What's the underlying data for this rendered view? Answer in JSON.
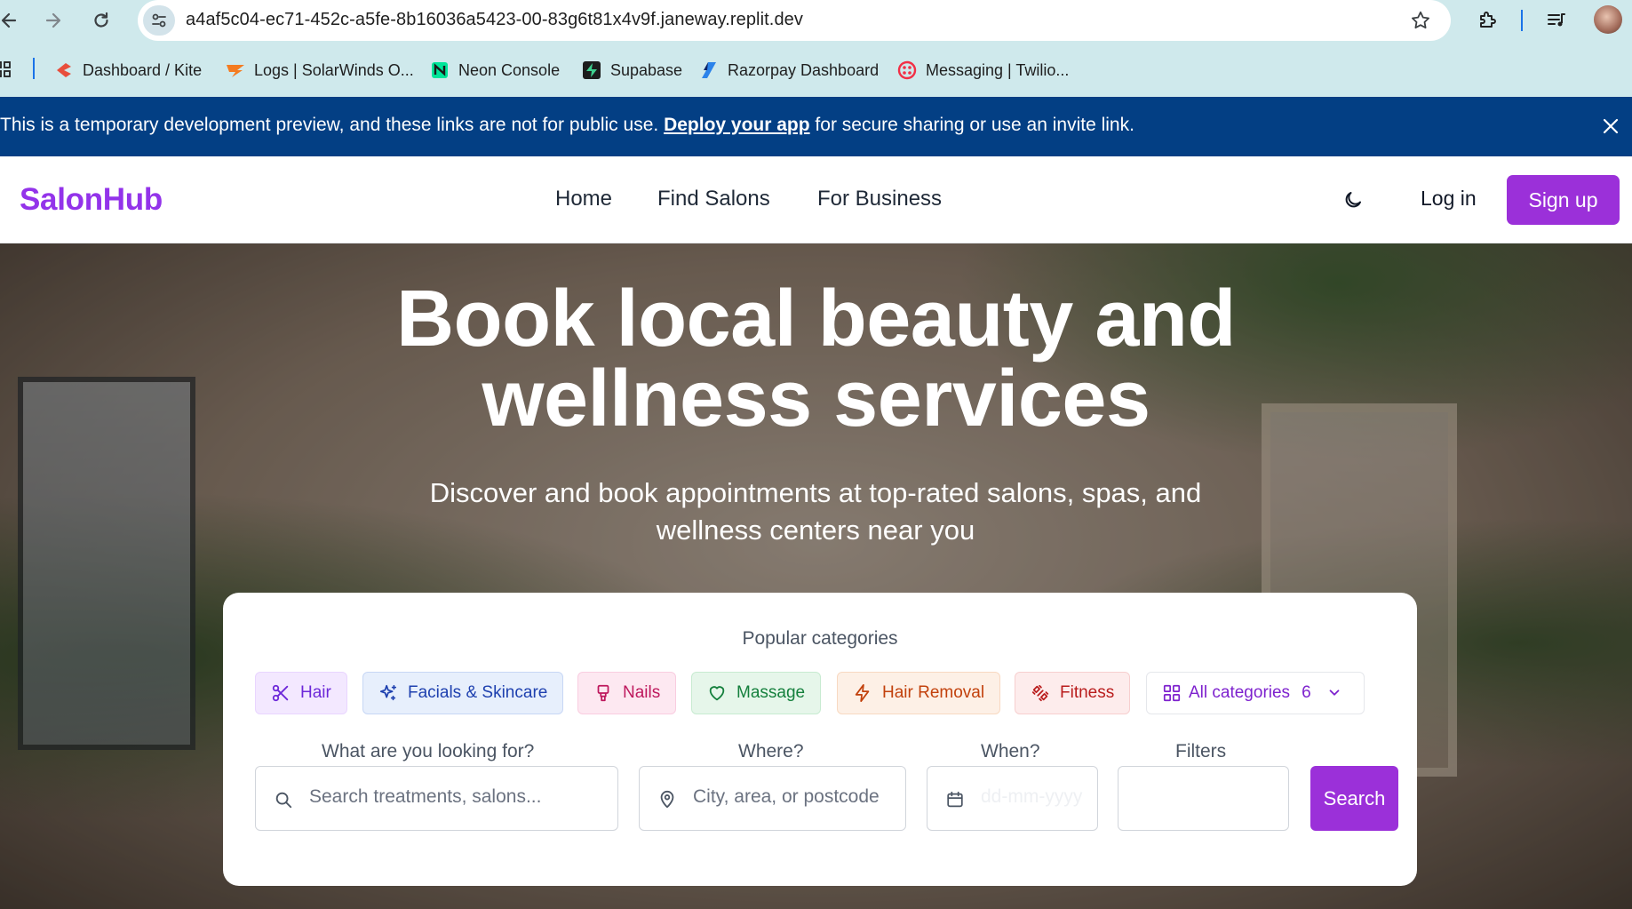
{
  "browser": {
    "url": "a4af5c04-ec71-452c-a5fe-8b16036a5423-00-83g6t81x4v9f.janeway.replit.dev",
    "bookmarks": [
      {
        "label": "Dashboard / Kite",
        "icon": "kite-icon"
      },
      {
        "label": "Logs | SolarWinds O...",
        "icon": "solarwinds-icon"
      },
      {
        "label": "Neon Console",
        "icon": "neon-icon"
      },
      {
        "label": "Supabase",
        "icon": "supabase-icon"
      },
      {
        "label": "Razorpay Dashboard",
        "icon": "razorpay-icon"
      },
      {
        "label": "Messaging | Twilio...",
        "icon": "twilio-icon"
      }
    ]
  },
  "banner": {
    "text_before": "This is a temporary development preview, and these links are not for public use. ",
    "link": "Deploy your app",
    "text_after": " for secure sharing or use an invite link."
  },
  "header": {
    "logo": "SalonHub",
    "nav": [
      "Home",
      "Find Salons",
      "For Business"
    ],
    "login": "Log in",
    "signup": "Sign up"
  },
  "hero": {
    "title_line1": "Book local beauty and",
    "title_line2": "wellness services",
    "subtitle_line1": "Discover and book appointments at top-rated salons, spas, and",
    "subtitle_line2": "wellness centers near you"
  },
  "search": {
    "categories_title": "Popular categories",
    "categories": [
      {
        "label": "Hair",
        "icon": "scissors-icon",
        "color": "#6d28d9",
        "bg": "#f3e8ff",
        "border": "#e9d5ff"
      },
      {
        "label": "Facials & Skincare",
        "icon": "sparkles-icon",
        "color": "#1e40af",
        "bg": "#e7effc",
        "border": "#c7d7f5"
      },
      {
        "label": "Nails",
        "icon": "nail-polish-icon",
        "color": "#be185d",
        "bg": "#fde8f1",
        "border": "#f9cde0"
      },
      {
        "label": "Massage",
        "icon": "heart-icon",
        "color": "#15803d",
        "bg": "#e6f6ea",
        "border": "#c8ebd1"
      },
      {
        "label": "Hair Removal",
        "icon": "zap-icon",
        "color": "#c2410c",
        "bg": "#fdf0e6",
        "border": "#f8d9c1"
      },
      {
        "label": "Fitness",
        "icon": "dumbbell-icon",
        "color": "#b91c1c",
        "bg": "#fdecec",
        "border": "#f7cfcf"
      }
    ],
    "all_categories": {
      "label": "All categories",
      "count": "6",
      "color": "#7e22ce"
    },
    "labels": {
      "what": "What are you looking for?",
      "where": "Where?",
      "when": "When?",
      "filters": "Filters"
    },
    "placeholders": {
      "what": "Search treatments, salons...",
      "where": "City, area, or postcode",
      "when": "dd-mm-yyyy"
    },
    "button": "Search"
  },
  "colors": {
    "brand": "#9333ea",
    "banner": "#033f84"
  }
}
